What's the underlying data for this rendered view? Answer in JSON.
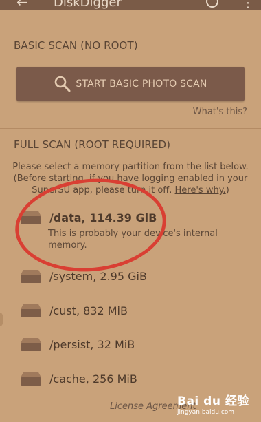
{
  "app": {
    "title": "DiskDigger"
  },
  "basic_scan": {
    "heading": "BASIC SCAN (NO ROOT)",
    "button_label": "START BASIC PHOTO SCAN",
    "whats_this": "What's this?"
  },
  "full_scan": {
    "heading": "FULL SCAN (ROOT REQUIRED)",
    "desc_line1": "Please select a memory partition from the list below.",
    "desc_line2": "(Before starting, if you have logging enabled in your",
    "desc_line3_pre": "SuperSU app, please turn it off. ",
    "desc_link": "Here's why.",
    "desc_line3_post": ")"
  },
  "partitions": [
    {
      "name": "/data, 114.39 GiB",
      "description": "This is probably your device's internal memory."
    },
    {
      "name": "/system, 2.95 GiB"
    },
    {
      "name": "/cust, 832 MiB"
    },
    {
      "name": "/persist, 32 MiB"
    },
    {
      "name": "/cache, 256 MiB"
    }
  ],
  "footer": {
    "license": "License Agreement"
  },
  "watermark": {
    "brand": "Bai du 经验",
    "url": "jingyan.baidu.com"
  },
  "colors": {
    "background": "#c9a27a",
    "button": "#7b5a4a",
    "highlight_oval": "#d93f33"
  },
  "icons": [
    "back-arrow-icon",
    "help-icon",
    "overflow-menu-icon",
    "search-icon",
    "drive-icon"
  ]
}
